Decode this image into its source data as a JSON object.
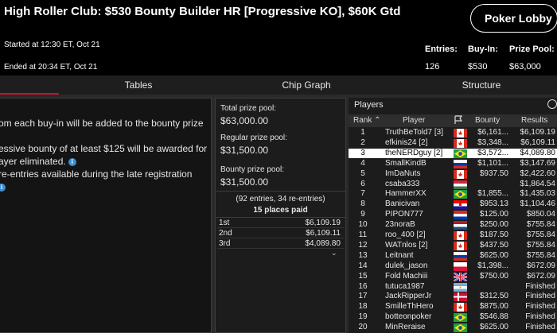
{
  "header": {
    "title": "High Roller Club: $530 Bounty Builder HR [Progressive KO], $60K Gtd",
    "lobby_button": "Poker Lobby",
    "started": "Started at 12:30 ET, Oct 21",
    "ended": "Ended at 20:34 ET, Oct 21",
    "entries_label": "Entries:",
    "entries_value": "126",
    "buyin_label": "Buy-In:",
    "buyin_value": "$530",
    "prizepool_label": "Prize Pool:",
    "prizepool_value": "$63,000"
  },
  "tabs": [
    {
      "label": "Tables",
      "active": true
    },
    {
      "label": "Chip Graph",
      "active": false
    },
    {
      "label": "Structure",
      "active": false
    }
  ],
  "info": {
    "line1": "om each buy-in will be added to the bounty prize",
    "line2": "essive bounty of at least $125 will be awarded for",
    "line3": "ayer eliminated.",
    "line4": "re-entries available during the late registration",
    "info_icon_glyph": "i",
    "accent_color": "#3d8fd6"
  },
  "prize_panel": {
    "total_label": "Total prize pool:",
    "total_value": "$63,000.00",
    "regular_label": "Regular prize pool:",
    "regular_value": "$31,500.00",
    "bounty_label": "Bounty prize pool:",
    "bounty_value": "$31,500.00",
    "entries_note": "(92 entries, 34 re-entries)",
    "places_paid": "15 places paid",
    "payouts": [
      {
        "place": "1st",
        "amount": "$6,109.19"
      },
      {
        "place": "2nd",
        "amount": "$6,109.11"
      },
      {
        "place": "3rd",
        "amount": "$4,089.80"
      }
    ],
    "more_icon": "chevron-down-icon"
  },
  "players": {
    "title": "Players",
    "columns": {
      "rank": "Rank",
      "player": "Player",
      "bounty": "Bounty",
      "results": "Results"
    },
    "rows": [
      {
        "rank": "1",
        "name": "TruthBeTold7 [3]",
        "flag": "ca",
        "bounty": "$6,161...",
        "result": "$6,109.19",
        "selected": false
      },
      {
        "rank": "2",
        "name": "efkinis24 [2]",
        "flag": "ca",
        "bounty": "$3,348...",
        "result": "$6,109.11",
        "selected": false
      },
      {
        "rank": "3",
        "name": "theNERDguy [2]",
        "flag": "br",
        "bounty": "$3,572...",
        "result": "$4,089.80",
        "selected": true
      },
      {
        "rank": "4",
        "name": "SmallKindB",
        "flag": "ru",
        "bounty": "$1,101...",
        "result": "$3,147.69",
        "selected": false
      },
      {
        "rank": "5",
        "name": "ImDaNuts",
        "flag": "ca",
        "bounty": "$937.50",
        "result": "$2,422.60",
        "selected": false
      },
      {
        "rank": "6",
        "name": "csaba333",
        "flag": "hu",
        "bounty": "",
        "result": "$1,864.54",
        "selected": false
      },
      {
        "rank": "7",
        "name": "HammerXX",
        "flag": "br",
        "bounty": "$1,855...",
        "result": "$1,435.03",
        "selected": false
      },
      {
        "rank": "8",
        "name": "Banicivan",
        "flag": "hr",
        "bounty": "$953.13",
        "result": "$1,104.46",
        "selected": false
      },
      {
        "rank": "9",
        "name": "PIPON777",
        "flag": "py",
        "bounty": "$125.00",
        "result": "$850.04",
        "selected": false
      },
      {
        "rank": "10",
        "name": "23noraB",
        "flag": "nl",
        "bounty": "$250.00",
        "result": "$755.84",
        "selected": false
      },
      {
        "rank": "11",
        "name": "roo_400 [2]",
        "flag": "ca",
        "bounty": "$187.50",
        "result": "$755.84",
        "selected": false
      },
      {
        "rank": "12",
        "name": "WATnlos [2]",
        "flag": "ca",
        "bounty": "$437.50",
        "result": "$755.84",
        "selected": false
      },
      {
        "rank": "13",
        "name": "Leitnant",
        "flag": "ru",
        "bounty": "$625.00",
        "result": "$755.84",
        "selected": false
      },
      {
        "rank": "14",
        "name": "dulek_jason",
        "flag": "pl",
        "bounty": "$1,398...",
        "result": "$672.09",
        "selected": false
      },
      {
        "rank": "15",
        "name": "Fold Machiii",
        "flag": "gb",
        "bounty": "$750.00",
        "result": "$672.09",
        "selected": false
      },
      {
        "rank": "16",
        "name": "tutuca1987",
        "flag": "ar",
        "bounty": "",
        "result": "Finished",
        "selected": false
      },
      {
        "rank": "17",
        "name": "JackRipperJr",
        "flag": "dk",
        "bounty": "$312.50",
        "result": "Finished",
        "selected": false
      },
      {
        "rank": "18",
        "name": "SmilleThHero",
        "flag": "ca",
        "bounty": "$875.00",
        "result": "Finished",
        "selected": false
      },
      {
        "rank": "19",
        "name": "botteonpoker",
        "flag": "br",
        "bounty": "$546.88",
        "result": "Finished",
        "selected": false
      },
      {
        "rank": "20",
        "name": "MinReraise",
        "flag": "br",
        "bounty": "$625.00",
        "result": "Finished",
        "selected": false
      }
    ]
  },
  "colors": {
    "accent_red": "#c8102e",
    "panel_dark": "#141414",
    "selected_row": "#ffffff"
  }
}
